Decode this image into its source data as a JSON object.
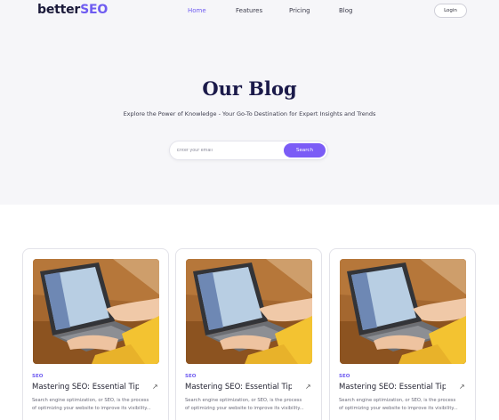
{
  "logo": {
    "main": "better",
    "accent": "SEO"
  },
  "nav": {
    "items": [
      {
        "label": "Home",
        "active": true
      },
      {
        "label": "Features",
        "active": false
      },
      {
        "label": "Pricing",
        "active": false
      },
      {
        "label": "Blog",
        "active": false
      }
    ],
    "login_label": "Login"
  },
  "hero": {
    "title": "Our Blog",
    "subtitle": "Explore the Power of Knowledge - Your Go-To Destination for Expert Insights and Trends"
  },
  "search": {
    "placeholder": "Enter your email",
    "button_label": "Search"
  },
  "cards": [
    {
      "tag": "SEO",
      "title": "Mastering SEO: Essential Tips for ...",
      "excerpt_line1": "Search engine optimization, or SEO, is the process",
      "excerpt_line2": "of optimizing your website to improve its visibility...",
      "image_icon": "laptop-photo"
    },
    {
      "tag": "SEO",
      "title": "Mastering SEO: Essential Tips for ...",
      "excerpt_line1": "Search engine optimization, or SEO, is the process",
      "excerpt_line2": "of optimizing your website to improve its visibility...",
      "image_icon": "laptop-photo"
    },
    {
      "tag": "SEO",
      "title": "Mastering SEO: Essential Tips for ...",
      "excerpt_line1": "Search engine optimization, or SEO, is the process",
      "excerpt_line2": "of optimizing your website to improve its visibility...",
      "image_icon": "laptop-photo"
    }
  ],
  "colors": {
    "accent": "#6f5cf1",
    "button": "#7b5cf6",
    "hero_bg": "#f6f6f9",
    "title": "#1b1a4a"
  }
}
